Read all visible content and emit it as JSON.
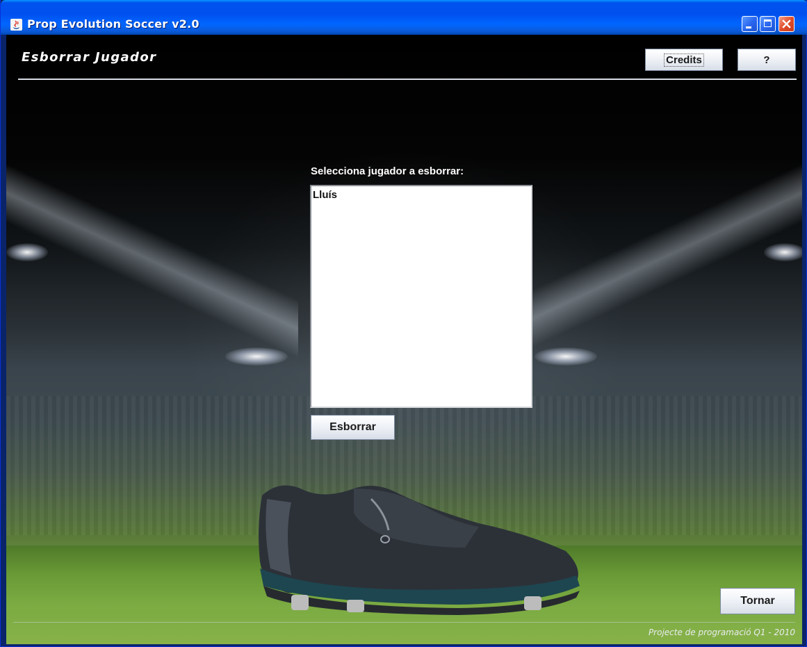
{
  "window": {
    "title": "Prop Evolution Soccer v2.0",
    "controls": [
      "minimize-icon",
      "maximize-icon",
      "close-icon"
    ]
  },
  "header": {
    "screen_title": "Esborrar Jugador",
    "credits_label": "Credits",
    "help_label": "?"
  },
  "main": {
    "select_label": "Selecciona jugador a esborrar:",
    "players": [
      "Lluís"
    ],
    "delete_label": "Esborrar"
  },
  "footer": {
    "back_label": "Tornar",
    "caption": "Projecte de programació Q1 - 2010"
  },
  "colors": {
    "titlebar": "#0053ee",
    "close_button": "#e24d2a",
    "text_on_dark": "#ffffff"
  }
}
